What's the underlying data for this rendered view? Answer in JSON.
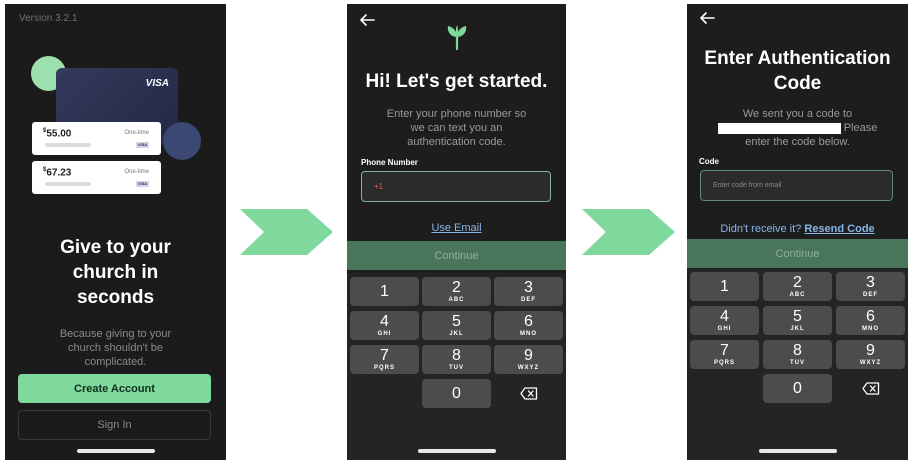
{
  "screen1": {
    "version": "Version 3.2.1",
    "card_brand": "VISA",
    "payments": [
      {
        "currency": "$",
        "amount": "55.00",
        "type": "One-time",
        "badge": "VISA"
      },
      {
        "currency": "$",
        "amount": "67.23",
        "type": "One-time",
        "badge": "VISA"
      }
    ],
    "title": "Give to your church in seconds",
    "subtitle": "Because giving to your church shouldn't be complicated.",
    "create_account": "Create Account",
    "sign_in": "Sign In"
  },
  "screen2": {
    "title": "Hi! Let's get started.",
    "subtitle": "Enter your phone number so we can text you an authentication code.",
    "phone_label": "Phone Number",
    "phone_value": "+1",
    "use_email": "Use Email",
    "continue": "Continue"
  },
  "screen3": {
    "title": "Enter Authentication Code",
    "subtitle_line1": "We sent you a code to",
    "subtitle_after_redaction": "Please",
    "subtitle_line3": "enter the code below.",
    "code_label": "Code",
    "code_placeholder": "Enter code from email",
    "didnt_receive": "Didn't receive it?",
    "resend": "Resend Code",
    "continue": "Continue"
  },
  "keypad": {
    "keys": [
      {
        "num": "1",
        "letters": ""
      },
      {
        "num": "2",
        "letters": "ABC"
      },
      {
        "num": "3",
        "letters": "DEF"
      },
      {
        "num": "4",
        "letters": "GHI"
      },
      {
        "num": "5",
        "letters": "JKL"
      },
      {
        "num": "6",
        "letters": "MNO"
      },
      {
        "num": "7",
        "letters": "PQRS"
      },
      {
        "num": "8",
        "letters": "TUV"
      },
      {
        "num": "9",
        "letters": "WXYZ"
      },
      {
        "num": "0",
        "letters": ""
      }
    ]
  },
  "colors": {
    "accent_green": "#7fd89c",
    "flow_arrow": "#7fd89c",
    "link_blue": "#86b6e8",
    "continue_bg": "#49755a",
    "screen_bg": "#1b1b1b"
  },
  "icons": [
    "back-arrow-icon",
    "leaf-logo-icon",
    "delete-backspace-icon",
    "flow-arrow-icon"
  ]
}
